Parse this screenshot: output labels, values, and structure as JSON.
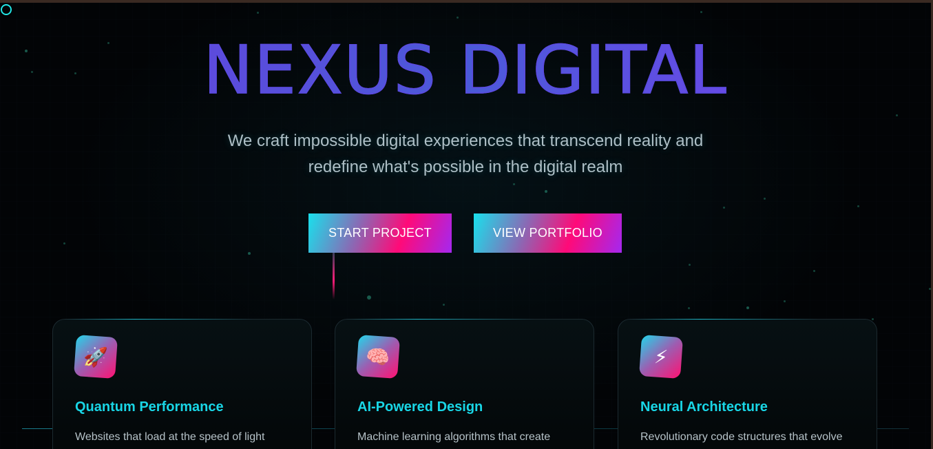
{
  "hero": {
    "title": "NEXUS DIGITAL",
    "subtitle_line1": "We craft impossible digital experiences that transcend reality and",
    "subtitle_line2": "redefine what's possible in the digital realm"
  },
  "buttons": {
    "start_label": "START PROJECT",
    "portfolio_label": "VIEW PORTFOLIO"
  },
  "features": [
    {
      "icon": "rocket-icon",
      "icon_glyph": "🚀",
      "title": "Quantum Performance",
      "description": "Websites that load at the speed of light"
    },
    {
      "icon": "brain-icon",
      "icon_glyph": "🧠",
      "title": "AI-Powered Design",
      "description": "Machine learning algorithms that create"
    },
    {
      "icon": "lightning-icon",
      "icon_glyph": "⚡",
      "title": "Neural Architecture",
      "description": "Revolutionary code structures that evolve"
    }
  ],
  "colors": {
    "accent_cyan": "#19d6e6",
    "accent_pink": "#ff0a78",
    "accent_purple": "#5b4be0",
    "background": "#020406"
  }
}
